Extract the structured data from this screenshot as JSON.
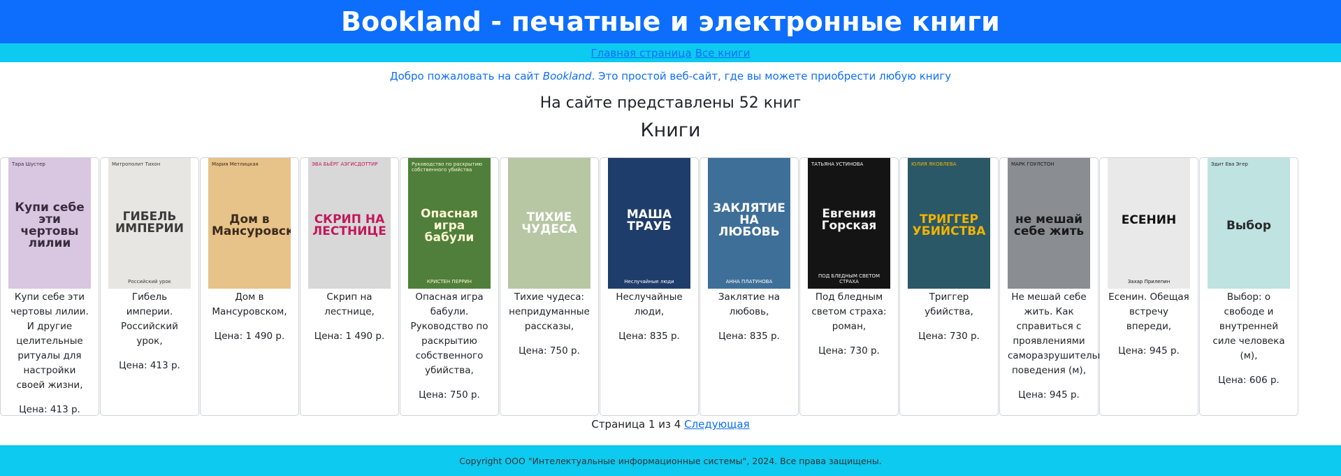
{
  "header": {
    "title": "Bookland - печатные и электронные книги"
  },
  "nav": {
    "home": "Главная страница",
    "all": "Все книги"
  },
  "welcome": {
    "before": "Добро пожаловать на сайт ",
    "brand": "Bookland",
    "after": ". Это простой веб-сайт, где вы можете приобрести любую книгу"
  },
  "count_text": "На сайте представлены 52 книг",
  "books_heading": "Книги",
  "books": [
    {
      "title": "Купи себе эти чертовы лилии. И другие целительные ритуалы для настройки своей жизни,",
      "price": "Цена: 413 р.",
      "cover_author": "Тара Шустер",
      "cover_title": "Купи себе эти чертовы лилии",
      "cover_sub": "",
      "bg": "#d9c6e0",
      "fg": "#3b2d3f"
    },
    {
      "title": "Гибель империи. Российский урок,",
      "price": "Цена: 413 р.",
      "cover_author": "Митрополит Тихон",
      "cover_title": "ГИБЕЛЬ ИМПЕРИИ",
      "cover_sub": "Российский урок",
      "bg": "#e8e6e3",
      "fg": "#3a3a3a"
    },
    {
      "title": "Дом в Мансуровском,",
      "price": "Цена: 1 490 р.",
      "cover_author": "Мария Метлицкая",
      "cover_title": "Дом в Мансуровском",
      "cover_sub": "",
      "bg": "#e7c38a",
      "fg": "#3b2b1d"
    },
    {
      "title": "Скрип на лестнице,",
      "price": "Цена: 1 490 р.",
      "cover_author": "ЭВА БЬЁРГ АЭГИСДОТТИР",
      "cover_title": "СКРИП НА ЛЕСТНИЦЕ",
      "cover_sub": "",
      "bg": "#d8d8d8",
      "fg": "#c2185b"
    },
    {
      "title": "Опасная игра бабули. Руководство по раскрытию собственного убийства,",
      "price": "Цена: 750 р.",
      "cover_author": "Руководство по раскрытию собственного убийства",
      "cover_title": "Опасная игра бабули",
      "cover_sub": "КРИСТЕН ПЕРРИН",
      "bg": "#4f7f3a",
      "fg": "#fff6d5"
    },
    {
      "title": "Тихие чудеса: непридуманные рассказы,",
      "price": "Цена: 750 р.",
      "cover_author": "",
      "cover_title": "ТИХИЕ ЧУДЕСА",
      "cover_sub": "",
      "bg": "#b7c7a3",
      "fg": "#ffffff"
    },
    {
      "title": "Неслучайные люди,",
      "price": "Цена: 835 р.",
      "cover_author": "",
      "cover_title": "МАША ТРАУБ",
      "cover_sub": "Неслучайные люди",
      "bg": "#1f3d6b",
      "fg": "#ffffff"
    },
    {
      "title": "Заклятие на любовь,",
      "price": "Цена: 835 р.",
      "cover_author": "",
      "cover_title": "ЗАКЛЯТИЕ НА ЛЮБОВЬ",
      "cover_sub": "АННА ПЛАТУНОВА",
      "bg": "#3e6f98",
      "fg": "#ffffff"
    },
    {
      "title": "Под бледным светом страха: роман,",
      "price": "Цена: 730 р.",
      "cover_author": "ТАТЬЯНА УСТИНОВА",
      "cover_title": "Евгения Горская",
      "cover_sub": "ПОД БЛЕДНЫМ СВЕТОМ СТРАХА",
      "bg": "#141414",
      "fg": "#f3f3f3"
    },
    {
      "title": "Триггер убийства,",
      "price": "Цена: 730 р.",
      "cover_author": "ЮЛИЯ ЯКОВЛЕВА",
      "cover_title": "ТРИГГЕР УБИЙСТВА",
      "cover_sub": "",
      "bg": "#2a5866",
      "fg": "#f4b400"
    },
    {
      "title": "Не мешай себе жить. Как справиться с проявлениями саморазрушительного поведения (м),",
      "price": "Цена: 945 р.",
      "cover_author": "МАРК ГОУЛСТОН",
      "cover_title": "не мешай себе жить",
      "cover_sub": "",
      "bg": "#8a8d92",
      "fg": "#1a1a1a"
    },
    {
      "title": "Есенин. Обещая встречу впереди,",
      "price": "Цена: 945 р.",
      "cover_author": "",
      "cover_title": "ЕСЕНИН",
      "cover_sub": "Захар Прилепин",
      "bg": "#e9e9e9",
      "fg": "#111111"
    },
    {
      "title": "Выбор: о свободе и внутренней силе человека (м),",
      "price": "Цена: 606 р.",
      "cover_author": "Эдит Ева Эгер",
      "cover_title": "Выбор",
      "cover_sub": "",
      "bg": "#bfe3e0",
      "fg": "#2a2a2a"
    }
  ],
  "pager": {
    "text": "Страница 1 из 4",
    "next": "Следующая"
  },
  "footer": {
    "text": "Copyright ООО \"Интелектуальные информационные системы\", 2024. Все права защищены."
  }
}
